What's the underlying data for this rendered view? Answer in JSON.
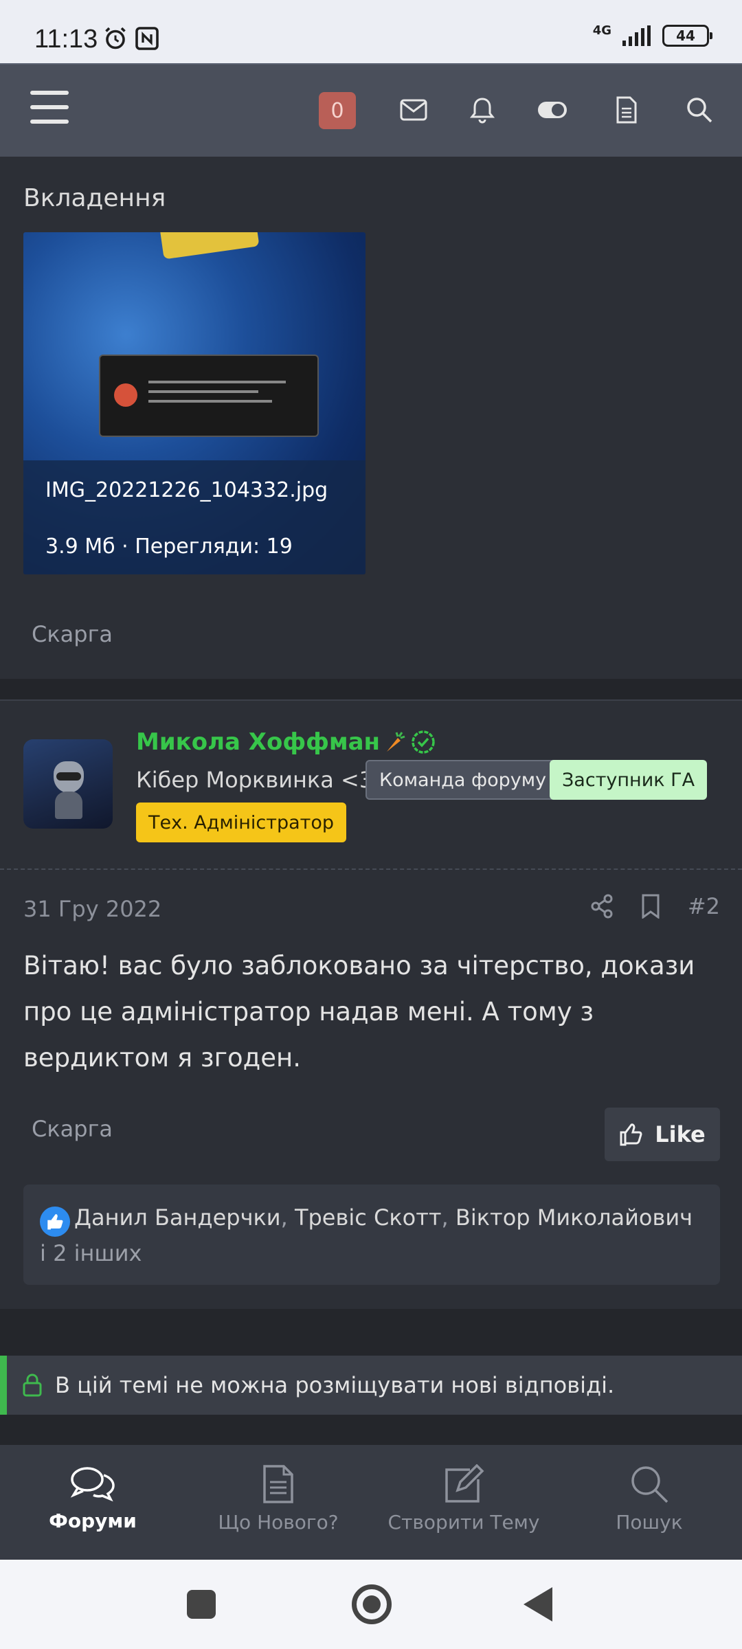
{
  "status_bar": {
    "time": "11:13",
    "network": "4G",
    "battery": "44"
  },
  "header": {
    "notification_count": "0",
    "icons": [
      "menu-icon",
      "mail-icon",
      "bell-icon",
      "toggle-icon",
      "document-icon",
      "search-icon"
    ]
  },
  "attachments": {
    "title": "Вкладення",
    "file_name": "IMG_20221226_104332.jpg",
    "file_meta": "3.9 Мб · Перегляди: 19",
    "report_label": "Скарга"
  },
  "post": {
    "author": "Микола Хоффман",
    "author_color": "#37c64a",
    "user_title": "Кібер Морквинка <3",
    "badges": [
      "Команда форуму",
      "Заступник ГА",
      "Тех. Адміністратор"
    ],
    "date": "31 Гру 2022",
    "number": "#2",
    "body": "Вітаю! вас було заблоковано за чітерство, докази про це адміністратор надав мені. А тому з вердиктом я згоден.",
    "report_label": "Скарга",
    "like_label": "Like",
    "likes": {
      "names": [
        "Данил Бандерчки",
        "Тревіс Скотт",
        "Віктор Миколайович"
      ],
      "others": "і 2 інших"
    }
  },
  "locked_notice": "В цій темі не можна розміщувати нові відповіді.",
  "bottom_nav": [
    {
      "label": "Форуми",
      "icon": "chat-bubbles-icon",
      "active": true
    },
    {
      "label": "Що Нового?",
      "icon": "document-icon",
      "active": false
    },
    {
      "label": "Створити Тему",
      "icon": "edit-icon",
      "active": false
    },
    {
      "label": "Пошук",
      "icon": "search-icon",
      "active": false
    }
  ],
  "colors": {
    "accent_green": "#3fb94e",
    "badge_red": "#b95f57",
    "like_blue": "#2d8cf0"
  }
}
